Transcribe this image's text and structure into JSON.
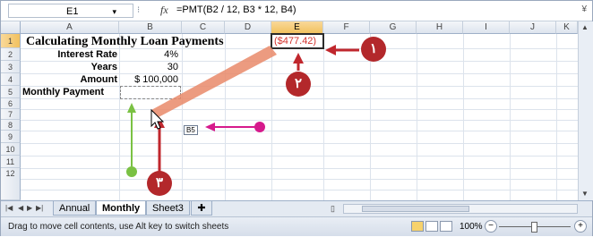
{
  "formula_bar": {
    "name_box": "E1",
    "fx_label": "fx",
    "formula": "=PMT(B2 / 12, B3 * 12, B4)",
    "expand_glyph": "¥"
  },
  "columns": [
    "A",
    "B",
    "C",
    "D",
    "E",
    "F",
    "G",
    "H",
    "I",
    "J",
    "K"
  ],
  "rows": [
    "1",
    "2",
    "3",
    "4",
    "5",
    "6",
    "7",
    "8",
    "9",
    "10",
    "11",
    "12"
  ],
  "cells": {
    "title": "Calculating Monthly Loan Payments",
    "a2": "Interest Rate",
    "b2": "4%",
    "a3": "Years",
    "b3": "30",
    "a4": "Amount",
    "b4": "$ 100,000",
    "a5": "Monthly Payment",
    "e1": "($477.42)"
  },
  "drag_tooltip": "B5",
  "callouts": {
    "one": "١",
    "two": "٢",
    "three": "٣"
  },
  "sheet_tabs": [
    "Annual",
    "Monthly",
    "Sheet3"
  ],
  "active_tab": "Monthly",
  "status": {
    "message": "Drag to move cell contents, use Alt key to switch sheets",
    "zoom": "100%",
    "zoom_minus": "−",
    "zoom_plus": "+"
  },
  "colors": {
    "result": "#d3332d",
    "badge": "#b3282b",
    "arrow_red": "#c0272d",
    "arrow_green": "#7ac143",
    "arrow_magenta": "#d61a8c"
  },
  "icons": [
    "dropdown-arrow-icon",
    "fx-icon",
    "sheet-nav-first-icon",
    "sheet-nav-prev-icon",
    "sheet-nav-next-icon",
    "sheet-nav-last-icon",
    "new-sheet-icon",
    "normal-view-icon",
    "page-layout-icon",
    "page-break-icon"
  ]
}
